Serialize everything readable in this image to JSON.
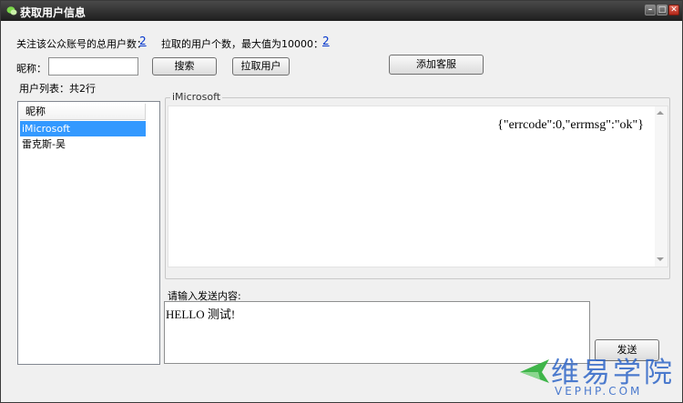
{
  "window": {
    "title": "获取用户信息",
    "icon": "wechat-icon",
    "controls": [
      "minimize-icon",
      "maximize-icon",
      "close-icon"
    ]
  },
  "stats": {
    "total_followers_label": "关注该公众账号的总用户数：",
    "total_followers_value": "2",
    "fetched_label": "拉取的用户个数，最大值为10000：",
    "fetched_value": "2"
  },
  "search": {
    "nickname_label": "昵称：",
    "nickname_value": "",
    "search_button": "搜索",
    "pull_users_button": "拉取用户",
    "add_customer_service_button": "添加客服"
  },
  "user_list": {
    "summary": "用户列表：共2行",
    "column_header": "昵称",
    "rows": [
      "iMicrosoft",
      "雷克斯-吴"
    ],
    "selected_index": 0
  },
  "response": {
    "group_title": "iMicrosoft",
    "text": "{\"errcode\":0,\"errmsg\":\"ok\"}"
  },
  "send": {
    "label": "请输入发送内容:",
    "content": "HELLO 测试!",
    "send_button": "发送"
  },
  "watermark": {
    "cn": "维易学院",
    "en": "VEPHP.COM"
  },
  "colors": {
    "link": "#0033cc",
    "selection": "#3399ff",
    "titlebar": "#2a2a2a",
    "watermark": "#2f66c8",
    "watermark_logo": "#3fb54a"
  }
}
